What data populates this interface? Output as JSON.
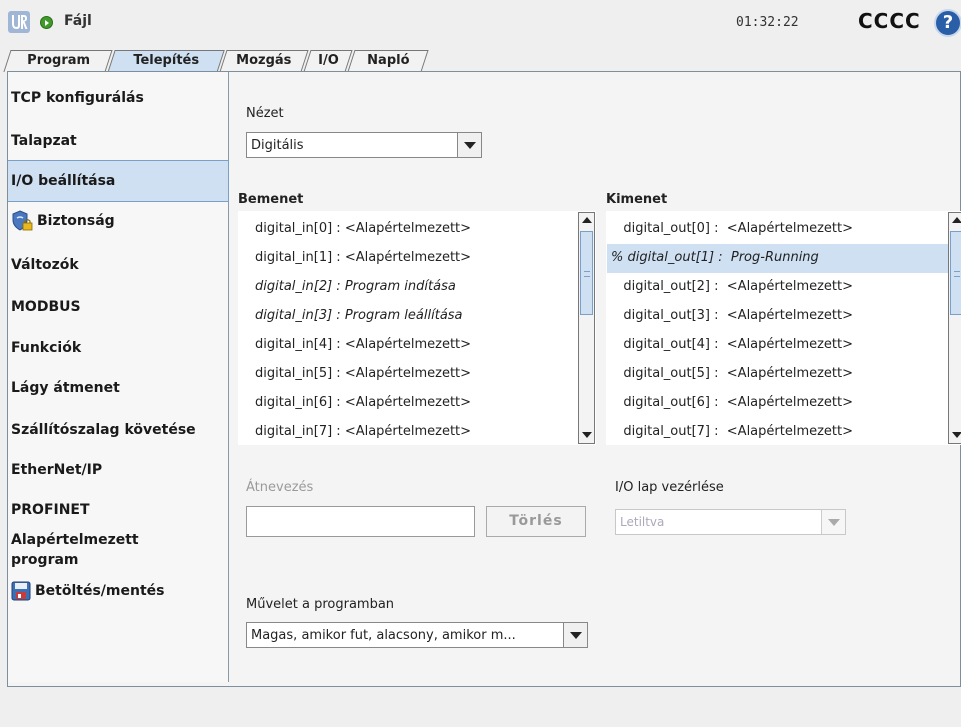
{
  "header": {
    "file_menu": "Fájl",
    "clock": "01:32:22",
    "robot_name": "CCCC",
    "help": "?"
  },
  "tabs": [
    {
      "label": "Program"
    },
    {
      "label": "Telepítés",
      "active": true
    },
    {
      "label": "Mozgás"
    },
    {
      "label": "I/O"
    },
    {
      "label": "Napló"
    }
  ],
  "sidebar": {
    "items": [
      {
        "label": "TCP konfigurálás"
      },
      {
        "label": "Talapzat"
      },
      {
        "label": "I/O beállítása",
        "active": true
      },
      {
        "label": "Biztonság",
        "icon": "shield-lock-icon"
      },
      {
        "label": "Változók"
      },
      {
        "label": "MODBUS"
      },
      {
        "label": "Funkciók"
      },
      {
        "label": "Lágy átmenet"
      },
      {
        "label": "Szállítószalag követése"
      },
      {
        "label": "EtherNet/IP"
      },
      {
        "label": "PROFINET"
      },
      {
        "label": "Alapértelmezett\nprogram"
      },
      {
        "label": "Betöltés/mentés",
        "icon": "save-disk-icon"
      }
    ]
  },
  "view": {
    "label": "Nézet",
    "selected": "Digitális"
  },
  "inputs": {
    "title": "Bemenet",
    "rows": [
      {
        "text": "digital_in[0]  :  <Alapértelmezett>",
        "italic": false
      },
      {
        "text": "digital_in[1]  :  <Alapértelmezett>",
        "italic": false
      },
      {
        "text": "digital_in[2]  :  Program indítása",
        "italic": true
      },
      {
        "text": "digital_in[3]  :  Program leállítása",
        "italic": true
      },
      {
        "text": "digital_in[4]  :  <Alapértelmezett>",
        "italic": false
      },
      {
        "text": "digital_in[5]  :  <Alapértelmezett>",
        "italic": false
      },
      {
        "text": "digital_in[6]  :  <Alapértelmezett>",
        "italic": false
      },
      {
        "text": "digital_in[7]  :  <Alapértelmezett>",
        "italic": false
      }
    ]
  },
  "outputs": {
    "title": "Kimenet",
    "rows": [
      {
        "text": "   digital_out[0] :  <Alapértelmezett>",
        "italic": false,
        "selected": false
      },
      {
        "text": "% digital_out[1] :  Prog-Running",
        "italic": true,
        "selected": true
      },
      {
        "text": "   digital_out[2] :  <Alapértelmezett>",
        "italic": false,
        "selected": false
      },
      {
        "text": "   digital_out[3] :  <Alapértelmezett>",
        "italic": false,
        "selected": false
      },
      {
        "text": "   digital_out[4] :  <Alapértelmezett>",
        "italic": false,
        "selected": false
      },
      {
        "text": "   digital_out[5] :  <Alapértelmezett>",
        "italic": false,
        "selected": false
      },
      {
        "text": "   digital_out[6] :  <Alapértelmezett>",
        "italic": false,
        "selected": false
      },
      {
        "text": "   digital_out[7] :  <Alapértelmezett>",
        "italic": false,
        "selected": false
      }
    ]
  },
  "rename": {
    "label": "Átnevezés",
    "value": "",
    "delete_label": "Törlés"
  },
  "io_tab_control": {
    "label": "I/O lap vezérlése",
    "selected": "Letiltva"
  },
  "program_action": {
    "label": "Művelet a programban",
    "selected": "Magas, amikor fut, alacsony, amikor m..."
  },
  "colors": {
    "selection": "#cfe0f3",
    "accent_blue": "#2a5fa8",
    "status_green": "#3f9a2a"
  }
}
